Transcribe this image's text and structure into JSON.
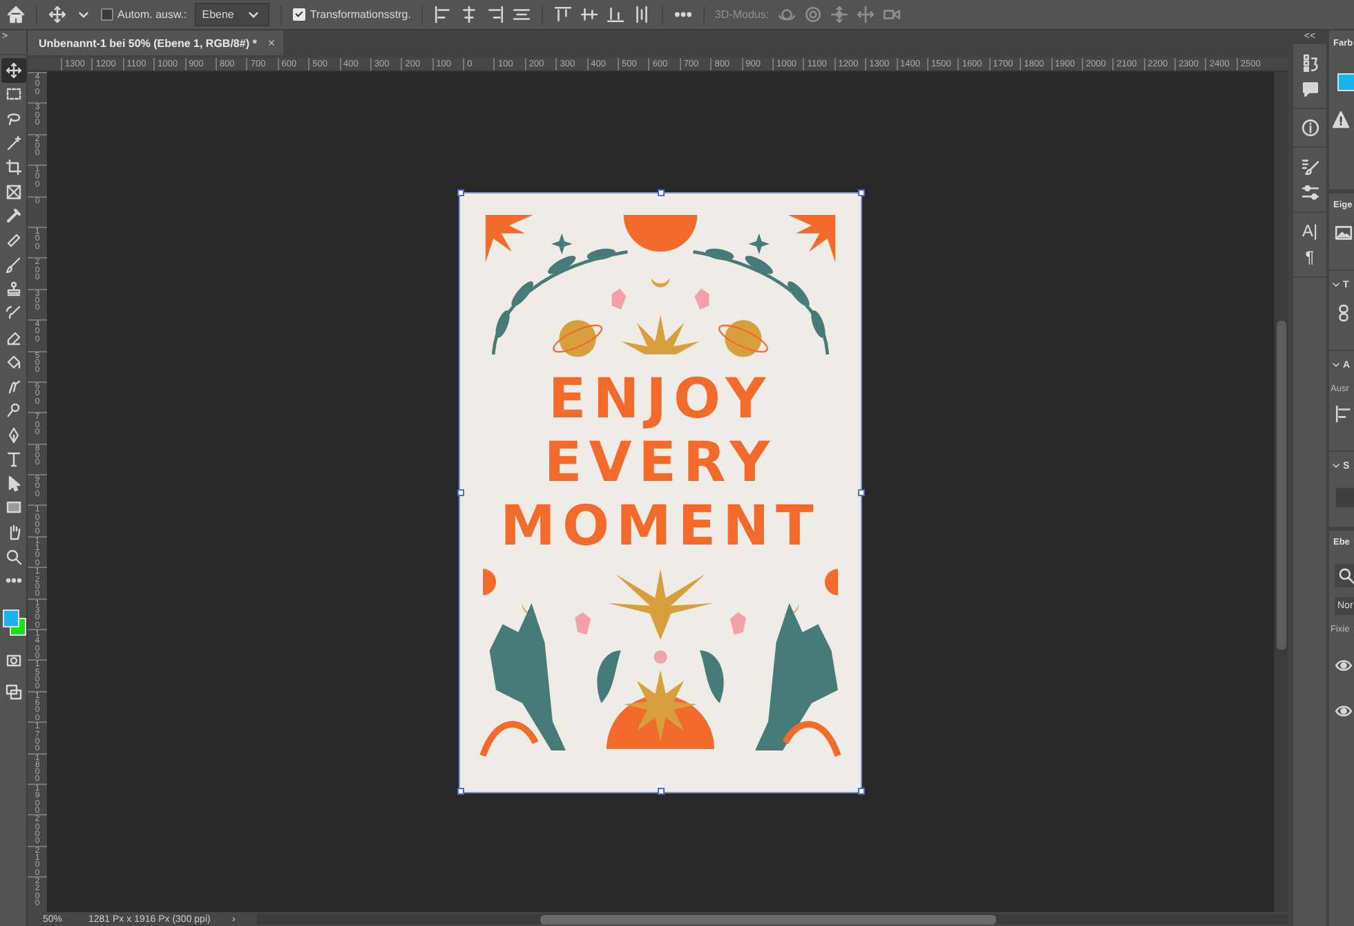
{
  "options_bar": {
    "groups": [
      [
        {
          "kind": "icon"
        }
      ],
      [
        {
          "kind": "icon"
        },
        {
          "kind": "icon"
        },
        {
          "kind": "checkbox",
          "label": "Autom. ausw.:",
          "checked": false
        },
        {
          "kind": "dropdown",
          "value": "Ebene"
        }
      ],
      [
        {
          "kind": "checkbox",
          "label": "Transformationsstrg.",
          "checked": true
        }
      ],
      [
        {
          "kind": "icon"
        },
        {
          "kind": "icon"
        },
        {
          "kind": "icon"
        },
        {
          "kind": "icon"
        }
      ],
      [
        {
          "kind": "icon"
        },
        {
          "kind": "icon"
        },
        {
          "kind": "icon"
        },
        {
          "kind": "icon"
        }
      ],
      [
        {
          "kind": "icon"
        }
      ]
    ],
    "mode_3d": {
      "label": "3D-Modus:",
      "disabled": true
    }
  },
  "toolbar": {
    "collapse": ">",
    "tools": [
      {
        "kind": "move",
        "selected": true
      },
      {
        "kind": "marquee",
        "selected": false
      },
      {
        "kind": "lasso",
        "selected": false
      },
      {
        "kind": "magic-wand",
        "selected": false
      },
      {
        "kind": "crop",
        "selected": false
      },
      {
        "kind": "frame",
        "selected": false
      },
      {
        "kind": "eyedropper",
        "selected": false
      },
      {
        "kind": "bandage",
        "selected": false
      },
      {
        "kind": "brush",
        "selected": false
      },
      {
        "kind": "stamp",
        "selected": false
      },
      {
        "kind": "history-brush",
        "selected": false
      },
      {
        "kind": "eraser",
        "selected": false
      },
      {
        "kind": "paint-bucket",
        "selected": false
      },
      {
        "kind": "smudge",
        "selected": false
      },
      {
        "kind": "dodge",
        "selected": false
      },
      {
        "kind": "pen",
        "selected": false
      },
      {
        "kind": "type",
        "selected": false
      },
      {
        "kind": "pointer",
        "selected": false
      },
      {
        "kind": "rectangle",
        "selected": false
      },
      {
        "kind": "hand",
        "selected": false
      },
      {
        "kind": "zoom",
        "selected": false
      },
      {
        "kind": "more",
        "selected": false
      }
    ],
    "colors": [
      {
        "color": "#19b4f0"
      },
      {
        "color": "#17e117"
      }
    ]
  },
  "document_tab": {
    "title": "Unbenannt-1 bei 50% (Ebene 1, RGB/8#) *",
    "close": "×",
    "selected": true
  },
  "rulers": {
    "horizontal": [
      "1300",
      "1200",
      "1100",
      "1000",
      "900",
      "800",
      "700",
      "600",
      "500",
      "400",
      "300",
      "200",
      "100",
      "0",
      "100",
      "200",
      "300",
      "400",
      "500",
      "600",
      "700",
      "800",
      "900",
      "1000",
      "1100",
      "1200",
      "1300",
      "1400",
      "1500",
      "1600",
      "1700",
      "1800",
      "1900",
      "2000",
      "2100",
      "2200",
      "2300",
      "2400",
      "2500"
    ],
    "vertical": [
      "400",
      "300",
      "200",
      "100",
      "0",
      "100",
      "200",
      "300",
      "400",
      "500",
      "600",
      "700",
      "800",
      "900",
      "1000",
      "1100",
      "1200",
      "1300",
      "1400",
      "1500",
      "1600",
      "1700",
      "1800",
      "1900",
      "2000",
      "2100",
      "2200"
    ]
  },
  "poster": {
    "lines": [
      "ENJOY",
      "EVERY",
      "MOMENT"
    ]
  },
  "status_bar": {
    "zoom": "50%",
    "document_info": "1281 Px x 1916 Px (300 ppi)",
    "arrow": "›"
  },
  "dock": {
    "collapse": "<<",
    "groups": [
      [
        {
          "kind": "icon"
        },
        {
          "kind": "icon"
        }
      ],
      [
        {
          "kind": "icon"
        }
      ],
      [
        {
          "kind": "icon"
        },
        {
          "kind": "icon"
        }
      ],
      [
        {
          "kind": "glyph",
          "text": "A|"
        },
        {
          "kind": "glyph",
          "text": "¶"
        }
      ]
    ]
  },
  "right_panel": [
    {
      "kind": "header",
      "text": "Farb"
    },
    {
      "kind": "swatch",
      "color": "#19b4f0"
    },
    {
      "kind": "warning"
    },
    {
      "kind": "header",
      "text": "Eige"
    },
    {
      "kind": "image"
    },
    {
      "kind": "section",
      "text": "T"
    },
    {
      "kind": "link"
    },
    {
      "kind": "section",
      "text": "A"
    },
    {
      "kind": "label",
      "text": "Ausr"
    },
    {
      "kind": "align"
    },
    {
      "kind": "section",
      "text": "S"
    },
    {
      "kind": "box"
    },
    {
      "kind": "header",
      "text": "Ebe"
    },
    {
      "kind": "search"
    },
    {
      "kind": "field",
      "text": "Nor"
    },
    {
      "kind": "label",
      "text": "Fixie"
    },
    {
      "kind": "eye"
    },
    {
      "kind": "eye"
    }
  ]
}
